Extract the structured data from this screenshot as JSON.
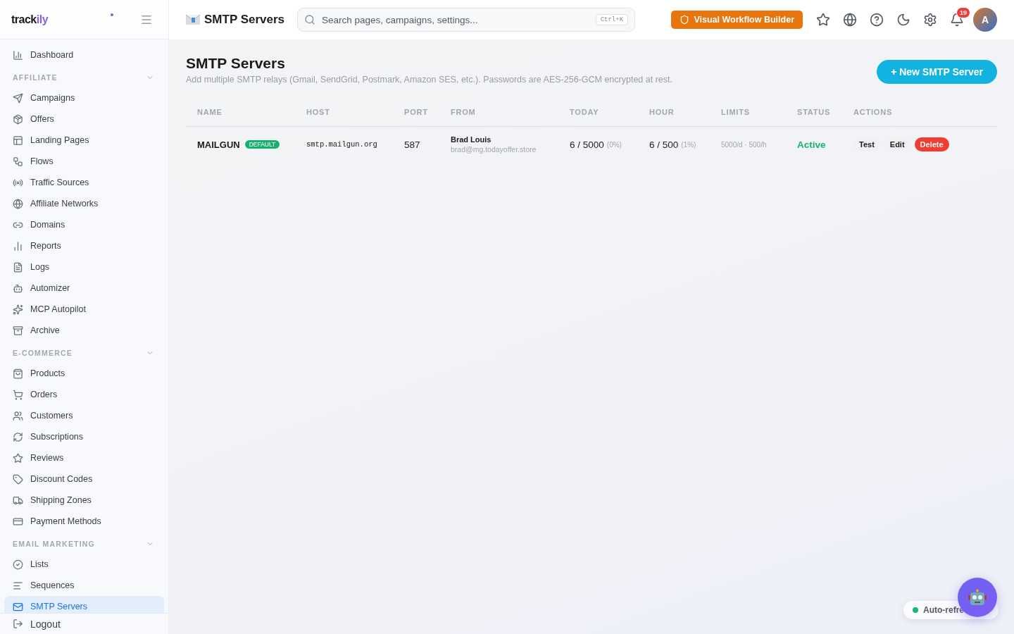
{
  "logo": {
    "text": "track",
    "accent": "ily"
  },
  "sidebar": {
    "top_items": [
      {
        "label": "Dashboard",
        "selected": false
      }
    ],
    "sections": [
      {
        "title": "AFFILIATE",
        "expanded": true,
        "items": [
          {
            "label": "Campaigns",
            "selected": false
          },
          {
            "label": "Offers",
            "selected": false
          },
          {
            "label": "Landing Pages",
            "selected": false
          },
          {
            "label": "Flows",
            "selected": false
          },
          {
            "label": "Traffic Sources",
            "selected": false
          },
          {
            "label": "Affiliate Networks",
            "selected": false
          },
          {
            "label": "Domains",
            "selected": false
          },
          {
            "label": "Reports",
            "selected": false
          },
          {
            "label": "Logs",
            "selected": false
          },
          {
            "label": "Automizer",
            "selected": false
          },
          {
            "label": "MCP Autopilot",
            "selected": false
          },
          {
            "label": "Archive",
            "selected": false
          }
        ]
      },
      {
        "title": "E-COMMERCE",
        "expanded": true,
        "items": [
          {
            "label": "Products",
            "selected": false
          },
          {
            "label": "Orders",
            "selected": false
          },
          {
            "label": "Customers",
            "selected": false
          },
          {
            "label": "Subscriptions",
            "selected": false
          },
          {
            "label": "Reviews",
            "selected": false
          },
          {
            "label": "Discount Codes",
            "selected": false
          },
          {
            "label": "Shipping Zones",
            "selected": false
          },
          {
            "label": "Payment Methods",
            "selected": false
          }
        ]
      },
      {
        "title": "EMAIL MARKETING",
        "expanded": true,
        "items": [
          {
            "label": "Lists",
            "selected": false
          },
          {
            "label": "Sequences",
            "selected": false
          },
          {
            "label": "SMTP Servers",
            "selected": true
          }
        ]
      }
    ],
    "logout": "Logout"
  },
  "topbar": {
    "page_title": "SMTP Servers",
    "search": {
      "placeholder": "Search pages, campaigns, settings...",
      "shortcut": "Ctrl+K"
    },
    "workflow_button": "Visual Workflow Builder",
    "notifications": "19",
    "avatar": "A"
  },
  "page": {
    "title": "SMTP Servers",
    "subtitle": "Add multiple SMTP relays (Gmail, SendGrid, Postmark, Amazon SES, etc.). Passwords are AES-256-GCM encrypted at rest.",
    "new_button": "+ New SMTP Server"
  },
  "table": {
    "columns": [
      "NAME",
      "HOST",
      "PORT",
      "FROM",
      "TODAY",
      "HOUR",
      "LIMITS",
      "STATUS",
      "ACTIONS"
    ],
    "rows": [
      {
        "name": "MAILGUN",
        "badge": "DEFAULT",
        "host": "smtp.mailgun.org",
        "port": "587",
        "from_name": "Brad Louis",
        "from_email": "brad@mg.todayoffer.store",
        "today": "6 / 5000",
        "today_pct": "(0%)",
        "hour": "6 / 500",
        "hour_pct": "(1%)",
        "limits": "5000/d · 500/h",
        "status": "Active",
        "actions": [
          {
            "label": "Test",
            "kind": "plain"
          },
          {
            "label": "Edit",
            "kind": "plain"
          },
          {
            "label": "Delete",
            "kind": "danger"
          }
        ]
      }
    ]
  },
  "auto_refresh": {
    "label": "Auto-refre",
    "on": true
  }
}
